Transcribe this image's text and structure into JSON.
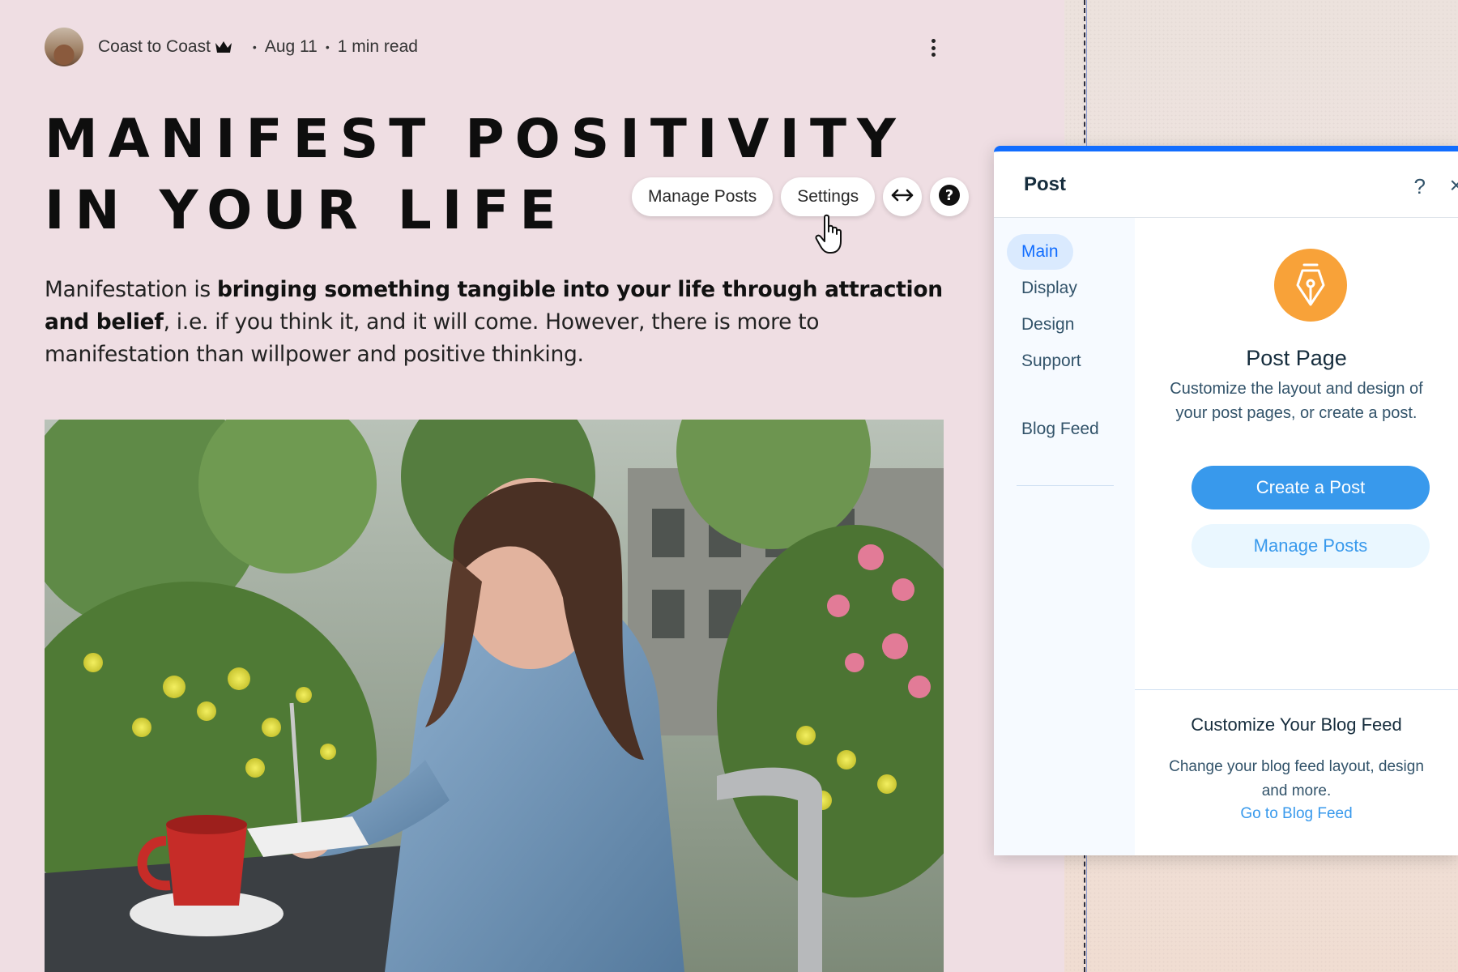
{
  "post": {
    "author": "Coast to Coast",
    "date": "Aug 11",
    "read_time": "1 min read",
    "title_line1": "MANIFEST POSITIVITY",
    "title_line2": "IN YOUR LIFE",
    "body_prefix": "Manifestation is ",
    "body_bold": "bringing something tangible into your life through attraction and belief",
    "body_suffix": ", i.e. if you think it, and it will come. However, there is more to manifestation than willpower and positive thinking."
  },
  "toolbar": {
    "manage_posts": "Manage Posts",
    "settings": "Settings"
  },
  "panel": {
    "title": "Post",
    "help": "?",
    "close": "×",
    "nav": [
      "Main",
      "Display",
      "Design",
      "Support",
      "Blog Feed"
    ],
    "post_page_title": "Post Page",
    "post_page_desc": "Customize the layout and design of your post pages, or create a post.",
    "create_post": "Create a Post",
    "manage_posts": "Manage Posts",
    "feed_title": "Customize Your Blog Feed",
    "feed_desc": "Change your blog feed layout, design and more.",
    "feed_link": "Go to Blog Feed"
  },
  "colors": {
    "page_bg": "#efdee3",
    "accent_blue": "#116dff",
    "button_blue": "#3899ec",
    "icon_orange": "#f8a239"
  },
  "icons": [
    "crown-icon",
    "more-icon",
    "arrows-horizontal-icon",
    "question-icon",
    "hand-cursor-icon",
    "pen-nib-icon",
    "help-icon",
    "close-icon"
  ]
}
